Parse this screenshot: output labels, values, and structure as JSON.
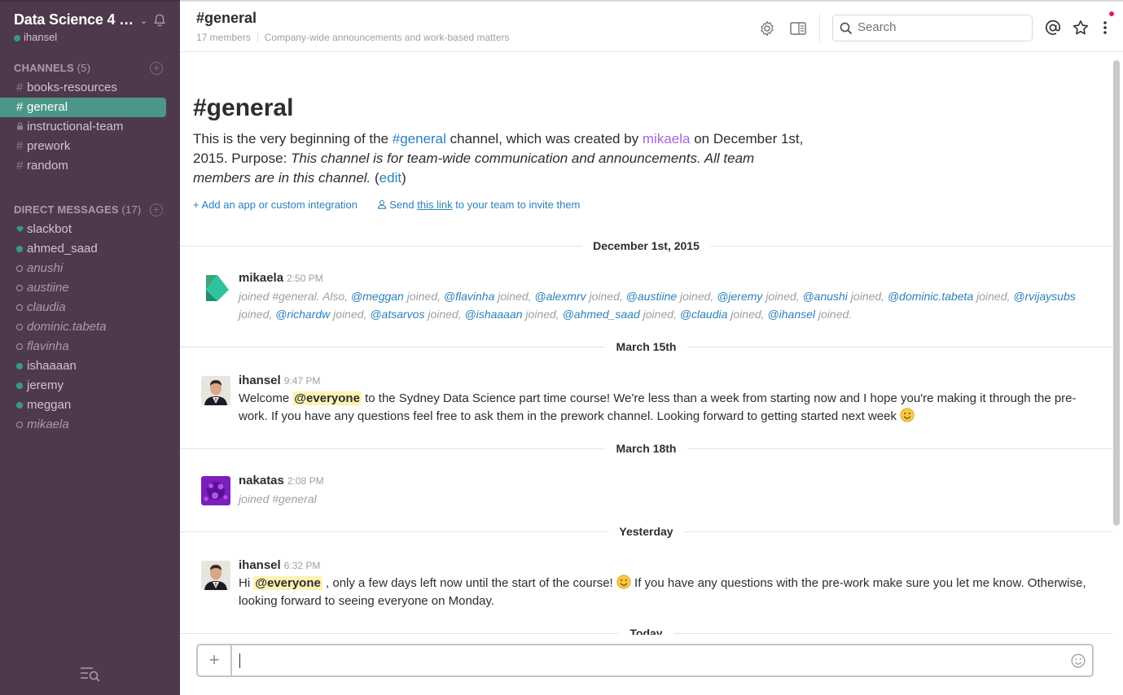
{
  "sidebar": {
    "team_name": "Data Science 4 S...",
    "chevron": "⌄",
    "user": "ihansel",
    "channels_label": "CHANNELS",
    "channels_count": "(5)",
    "channels": [
      {
        "prefix": "#",
        "label": "books-resources"
      },
      {
        "prefix": "#",
        "label": "general"
      },
      {
        "prefix": "🔒",
        "label": "instructional-team"
      },
      {
        "prefix": "#",
        "label": "prework"
      },
      {
        "prefix": "#",
        "label": "random"
      }
    ],
    "dm_label": "DIRECT MESSAGES",
    "dm_count": "(17)",
    "dms": [
      {
        "label": "slackbot",
        "status": "bot"
      },
      {
        "label": "ahmed_saad",
        "status": "online"
      },
      {
        "label": "anushi",
        "status": "away"
      },
      {
        "label": "austiine",
        "status": "away"
      },
      {
        "label": "claudia",
        "status": "away"
      },
      {
        "label": "dominic.tabeta",
        "status": "away"
      },
      {
        "label": "flavinha",
        "status": "away"
      },
      {
        "label": "ishaaaan",
        "status": "online"
      },
      {
        "label": "jeremy",
        "status": "online"
      },
      {
        "label": "meggan",
        "status": "online"
      },
      {
        "label": "mikaela",
        "status": "away"
      }
    ],
    "colors": {
      "bg": "#4d394b",
      "active": "#4c9689",
      "online": "#38978d"
    }
  },
  "header": {
    "title": "#general",
    "members": "17 members",
    "purpose": "Company-wide announcements and work-based matters",
    "search_placeholder": "Search"
  },
  "intro": {
    "title": "#general",
    "p1": "This is the very beginning of the ",
    "channel_link": "#general",
    "p2": " channel, which was created by ",
    "creator": "mikaela",
    "p3": " on December 1st, 2015. Purpose: ",
    "purpose": "This channel is for team-wide communication and announcements. All team members are in this channel.",
    "edit_open": " (",
    "edit": "edit",
    "edit_close": ")",
    "add_app": "+ Add an app or custom integration",
    "send_pre": "Send ",
    "send_link": "this link",
    "send_post": " to your team to invite them"
  },
  "days": [
    "December 1st, 2015",
    "March 15th",
    "March 18th",
    "Yesterday",
    "Today"
  ],
  "messages": [
    {
      "user": "mikaela",
      "time": "2:50 PM",
      "system": true,
      "lead": "joined #general. Also, ",
      "mentions": [
        "@meggan",
        "@flavinha",
        "@alexmrv",
        "@austiine",
        "@jeremy",
        "@anushi",
        "@dominic.tabeta",
        "@rvijaysubs",
        "@richardw",
        "@atsarvos",
        "@ishaaaan",
        "@ahmed_saad",
        "@claudia",
        "@ihansel"
      ],
      "joined": " joined,",
      "joined_last": " joined."
    },
    {
      "user": "ihansel",
      "time": "9:47 PM",
      "t1": "Welcome ",
      "mention": "@everyone",
      "t2": " to the Sydney Data Science part time course! We're less than a week from starting now and I hope you're making it through the pre-work. If you have any questions feel free to ask them in the prework channel. Looking forward to getting started next week "
    },
    {
      "user": "nakatas",
      "time": "2:08 PM",
      "text": "joined #general"
    },
    {
      "user": "ihansel",
      "time": "6:32 PM",
      "t1": "Hi ",
      "mention": "@everyone",
      "t2": " , only a few days left now until the start of the course! ",
      "t3": " If you have any questions with the pre-work make sure you let me know. Otherwise, looking forward to seeing everyone on Monday."
    }
  ],
  "composer": {
    "plus": "+",
    "value": ""
  }
}
